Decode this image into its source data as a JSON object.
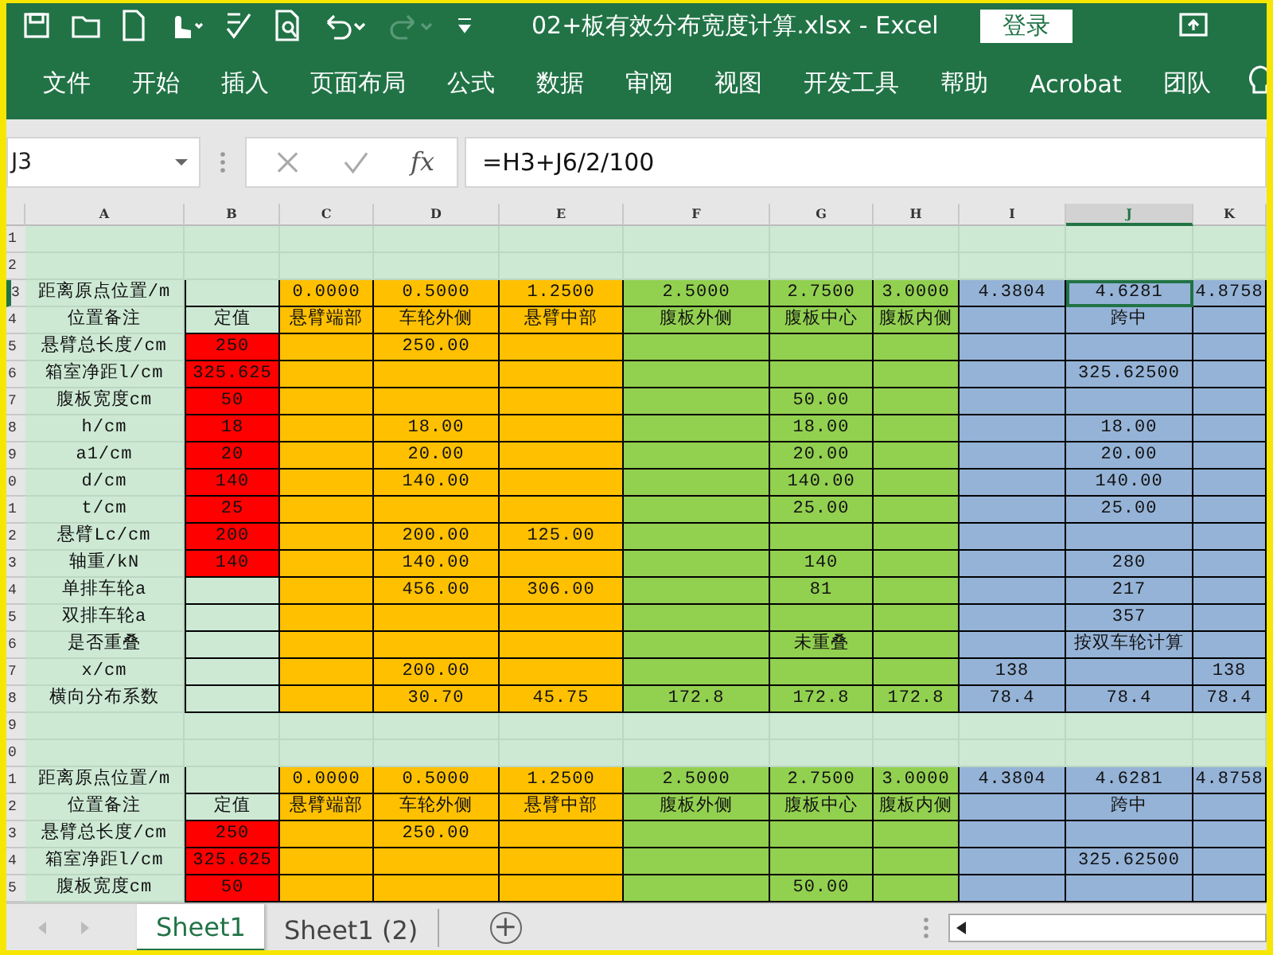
{
  "titlebar": {
    "title": "02+板有效分布宽度计算.xlsx - Excel",
    "login": "登录"
  },
  "ribbon_tabs": [
    "文件",
    "开始",
    "插入",
    "页面布局",
    "公式",
    "数据",
    "审阅",
    "视图",
    "开发工具",
    "帮助",
    "Acrobat",
    "团队"
  ],
  "formula_bar": {
    "name_box": "J3",
    "function_label": "fx",
    "formula": "=H3+J6/2/100"
  },
  "columns": [
    {
      "label": "A",
      "color": "#cde9d4",
      "selected": false
    },
    {
      "label": "B",
      "color": "#cde9d4",
      "selected": false
    },
    {
      "label": "C",
      "color": "#ffc000",
      "selected": false
    },
    {
      "label": "D",
      "color": "#ffc000",
      "selected": false
    },
    {
      "label": "E",
      "color": "#ffc000",
      "selected": false
    },
    {
      "label": "F",
      "color": "#92d050",
      "selected": false
    },
    {
      "label": "G",
      "color": "#92d050",
      "selected": false
    },
    {
      "label": "H",
      "color": "#92d050",
      "selected": false
    },
    {
      "label": "I",
      "color": "#95b3d7",
      "selected": false
    },
    {
      "label": "J",
      "color": "#95b3d7",
      "selected": true
    },
    {
      "label": "K",
      "color": "#95b3d7",
      "selected": false
    }
  ],
  "rows": [
    {
      "number": "1",
      "kind": "blank",
      "selected": false
    },
    {
      "number": "2",
      "kind": "blank",
      "selected": false
    },
    {
      "number": "3",
      "kind": "data",
      "selected": true,
      "cells": [
        "距离原点位置/m",
        "",
        "0.0000",
        "0.5000",
        "1.2500",
        "2.5000",
        "2.7500",
        "3.0000",
        "4.3804",
        "4.6281",
        "4.8758"
      ]
    },
    {
      "number": "4",
      "kind": "data",
      "selected": false,
      "cells": [
        "位置备注",
        "定值",
        "悬臂端部",
        "车轮外侧",
        "悬臂中部",
        "腹板外侧",
        "腹板中心",
        "腹板内侧",
        "",
        "跨中",
        ""
      ]
    },
    {
      "number": "5",
      "kind": "data",
      "selected": false,
      "color": "#ff0000",
      "cells": [
        "悬臂总长度/cm",
        "250",
        "",
        "250.00",
        "",
        "",
        "",
        "",
        "",
        "",
        ""
      ]
    },
    {
      "number": "6",
      "kind": "data",
      "selected": false,
      "color": "#ff0000",
      "cells": [
        "箱室净距l/cm",
        "325.625",
        "",
        "",
        "",
        "",
        "",
        "",
        "",
        "325.62500",
        ""
      ]
    },
    {
      "number": "7",
      "kind": "data",
      "selected": false,
      "color": "#ff0000",
      "cells": [
        "腹板宽度cm",
        "50",
        "",
        "",
        "",
        "",
        "50.00",
        "",
        "",
        "",
        ""
      ]
    },
    {
      "number": "8",
      "kind": "data",
      "selected": false,
      "color": "#ff0000",
      "cells": [
        "h/cm",
        "18",
        "",
        "18.00",
        "",
        "",
        "18.00",
        "",
        "",
        "18.00",
        ""
      ]
    },
    {
      "number": "9",
      "kind": "data",
      "selected": false,
      "color": "#ff0000",
      "cells": [
        "a1/cm",
        "20",
        "",
        "20.00",
        "",
        "",
        "20.00",
        "",
        "",
        "20.00",
        ""
      ]
    },
    {
      "number": "0",
      "kind": "data",
      "selected": false,
      "color": "#ff0000",
      "cells": [
        "d/cm",
        "140",
        "",
        "140.00",
        "",
        "",
        "140.00",
        "",
        "",
        "140.00",
        ""
      ]
    },
    {
      "number": "1",
      "kind": "data",
      "selected": false,
      "color": "#ff0000",
      "cells": [
        "t/cm",
        "25",
        "",
        "",
        "",
        "",
        "25.00",
        "",
        "",
        "25.00",
        ""
      ]
    },
    {
      "number": "2",
      "kind": "data",
      "selected": false,
      "color": "#ff0000",
      "cells": [
        "悬臂Lc/cm",
        "200",
        "",
        "200.00",
        "125.00",
        "",
        "",
        "",
        "",
        "",
        ""
      ]
    },
    {
      "number": "3",
      "kind": "data",
      "selected": false,
      "color": "#ff0000",
      "cells": [
        "轴重/kN",
        "140",
        "",
        "140.00",
        "",
        "",
        "140",
        "",
        "",
        "280",
        ""
      ]
    },
    {
      "number": "4",
      "kind": "data",
      "selected": false,
      "cells": [
        "单排车轮a",
        "",
        "",
        "456.00",
        "306.00",
        "",
        "81",
        "",
        "",
        "217",
        ""
      ]
    },
    {
      "number": "5",
      "kind": "data",
      "selected": false,
      "cells": [
        "双排车轮a",
        "",
        "",
        "",
        "",
        "",
        "",
        "",
        "",
        "357",
        ""
      ]
    },
    {
      "number": "6",
      "kind": "data",
      "selected": false,
      "cells": [
        "是否重叠",
        "",
        "",
        "",
        "",
        "",
        "未重叠",
        "",
        "",
        "按双车轮计算",
        ""
      ]
    },
    {
      "number": "7",
      "kind": "data",
      "selected": false,
      "cells": [
        "x/cm",
        "",
        "",
        "200.00",
        "",
        "",
        "",
        "",
        "138",
        "",
        "138"
      ]
    },
    {
      "number": "8",
      "kind": "data",
      "selected": false,
      "cells": [
        "横向分布系数",
        "",
        "",
        "30.70",
        "45.75",
        "172.8",
        "172.8",
        "172.8",
        "78.4",
        "78.4",
        "78.4"
      ]
    },
    {
      "number": "9",
      "kind": "blank",
      "selected": false
    },
    {
      "number": "0",
      "kind": "blank",
      "selected": false
    },
    {
      "number": "1",
      "kind": "data",
      "selected": false,
      "cells": [
        "距离原点位置/m",
        "",
        "0.0000",
        "0.5000",
        "1.2500",
        "2.5000",
        "2.7500",
        "3.0000",
        "4.3804",
        "4.6281",
        "4.8758"
      ]
    },
    {
      "number": "2",
      "kind": "data",
      "selected": false,
      "cells": [
        "位置备注",
        "定值",
        "悬臂端部",
        "车轮外侧",
        "悬臂中部",
        "腹板外侧",
        "腹板中心",
        "腹板内侧",
        "",
        "跨中",
        ""
      ]
    },
    {
      "number": "3",
      "kind": "data",
      "selected": false,
      "color": "#ff0000",
      "cells": [
        "悬臂总长度/cm",
        "250",
        "",
        "250.00",
        "",
        "",
        "",
        "",
        "",
        "",
        ""
      ]
    },
    {
      "number": "4",
      "kind": "data",
      "selected": false,
      "color": "#ff0000",
      "cells": [
        "箱室净距l/cm",
        "325.625",
        "",
        "",
        "",
        "",
        "",
        "",
        "",
        "325.62500",
        ""
      ]
    },
    {
      "number": "5",
      "kind": "data",
      "selected": false,
      "color": "#ff0000",
      "cells": [
        "腹板宽度cm",
        "50",
        "",
        "",
        "",
        "",
        "50.00",
        "",
        "",
        "",
        ""
      ]
    }
  ],
  "sheet_tabs": [
    {
      "label": "Sheet1",
      "selected": true
    },
    {
      "label": "Sheet1 (2)",
      "selected": false
    }
  ],
  "add_sheet": "+"
}
